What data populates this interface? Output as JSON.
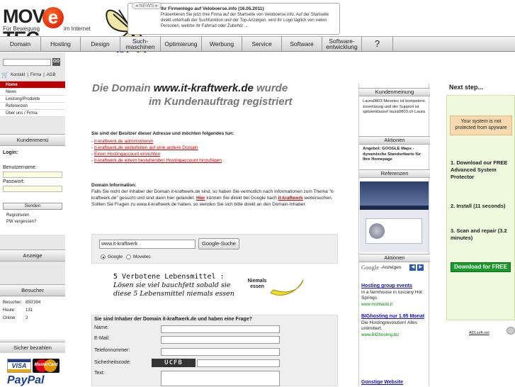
{
  "header": {
    "logo_main": "MOV TEC",
    "logo_e": "e",
    "logo_sub_left": "Für Bewegung",
    "logo_sub_right": "im Internet",
    "news_tab": "NEWS",
    "news_title": "Ihr Firmenlogo auf Veloboerse.info (16.05.2011)",
    "news_body": "Präsentieren Sie jetzt Ihre Firma auf der Startseite von Veloboerse.info. Auf der Startseite direkt unterhalb der Suchfunktion und der Top-Anzeigen. wird Ihr Logo täglich von vielen Personen, welche ihr Fahrrad oder Zubehör ..."
  },
  "nav": {
    "items": [
      {
        "label": "Domain"
      },
      {
        "label": "Hosting"
      },
      {
        "label": "Design"
      },
      {
        "label": "Such-maschinen"
      },
      {
        "label": "Optimierung"
      },
      {
        "label": "Werbung"
      },
      {
        "label": "Service"
      },
      {
        "label": "Software"
      },
      {
        "label": "Software-entwicklung"
      },
      {
        "label": "?"
      }
    ]
  },
  "left": {
    "go_label": "GO",
    "quicklinks": [
      "Kontakt",
      "Firma",
      "AGB"
    ],
    "menu": [
      "Home",
      "News",
      "Leistung/Produkte",
      "Referenzen",
      "Über uns / Firma"
    ],
    "kundenmenu_title": "Kundenmenü",
    "login_title": "Login:",
    "username_label": "Benutzername:",
    "password_label": "Passwort:",
    "send_label": "Senden",
    "register_link": "Registrieren",
    "forgot_link": "PW vergessen?",
    "anzeige_title": "Anzeige",
    "besucher_title": "Besucher",
    "stats": [
      {
        "k": "Besucher:",
        "v": "850'394"
      },
      {
        "k": "Heute:",
        "v": "131"
      },
      {
        "k": "Online:",
        "v": "2"
      }
    ],
    "pay_title": "Sicher bezahlen",
    "visa": "VISA",
    "mastercard": "MasterCard",
    "paypal": "PayPal"
  },
  "main": {
    "headline_pre": "Die Domain ",
    "headline_domain": "www.it-kraftwerk.de",
    "headline_post": " wurde",
    "headline_line2": "im Kundenauftrag registriert",
    "owner_q": "Sie sind der Besitzer dieser Adresse und möchten folgendes tun:",
    "owner_links": [
      "it-kraftwerk.de administrieren",
      "it-kraftwerk.de weiterleiten auf eine andere Domain",
      "Einen Hostingaccount einrichten",
      "it-kraftwerk.de einem bestehenden Hostingaccount hinzufügen"
    ],
    "info_title": "Domain Information:",
    "info_p1": "Falls Sie nicht der Inhaber der Domain it-kraftwerk.de sind, so haben Sie vermutlich nach Informationen zum Thema \"it-kraftwerk.de\" gesucht und sind dann hier gelandet. ",
    "info_hier": "Hier",
    "info_p2": " können Sie direkt bei Google nach ",
    "info_kw": "it-kraftwerk",
    "info_p3": " weitersuchen. Sollten Sie Fragen zu www.it-kraftwerk.de haben, so wenden Sie sich bitte direkt an den Domain-Inhaber.",
    "search_value": "www.it-kraftwerk",
    "search_button": "Google-Suche",
    "radio_google": "Google",
    "radio_movetec": "Movetec",
    "banner_l1": "5 Verbotene Lebensmittel :",
    "banner_l2": "Lösen sie viel bauchfett sobald sie",
    "banner_l3": "diese 5 Lebensmittel niemals essen",
    "banner_niemals": "Niemals essen",
    "contact_header": "Sie sind Inhaber der Domain it-kraftwerk.de und haben eine Frage?",
    "contact_labels": [
      "Name:",
      "E-Mail:",
      "Telefonnummer:",
      "Sicherheitscode:",
      "Text:"
    ],
    "captcha": "UCFB"
  },
  "rcol": {
    "kundenmeinung": "Kundenmeinung",
    "kundenmeinung_text": "Laura0803 Movetec ist kompetent, zuverlässig und der Support ist spitzenklasse! laura0803.ch Laura",
    "aktionen": "Aktionen",
    "aktionen_text": "Angebot: GOOGLE Maps - dynamische Standortkarte für Ihre Homepage",
    "referenzen": "Referenzen",
    "aktionen2": "Aktionen",
    "google_label": "Google",
    "anzeigen_label": "-Anzeigen",
    "ads": [
      {
        "title": "Hosting group events",
        "text": "in a farmhouse in tuscany Hot Springs",
        "url": "www.montauto.it"
      },
      {
        "title": "BIGhosting nur 1.95 Monat",
        "text": "Die Hostingrevolution! Alles unlimitiert.",
        "url": "www.BIGhosting.biz"
      },
      {
        "title": "Günstige Website",
        "text": "",
        "url": ""
      }
    ]
  },
  "promo": {
    "title": "Next step...",
    "warning": "Your system is not protected from spyware",
    "step1": "1. Download our FREE Advanced System Protector",
    "step2": "2. Install (11 seconds)",
    "step3": "3. Scan and repair (3.2 minutes)",
    "download": "Download for FREE",
    "adlsoft": "ADLsoft.net"
  }
}
